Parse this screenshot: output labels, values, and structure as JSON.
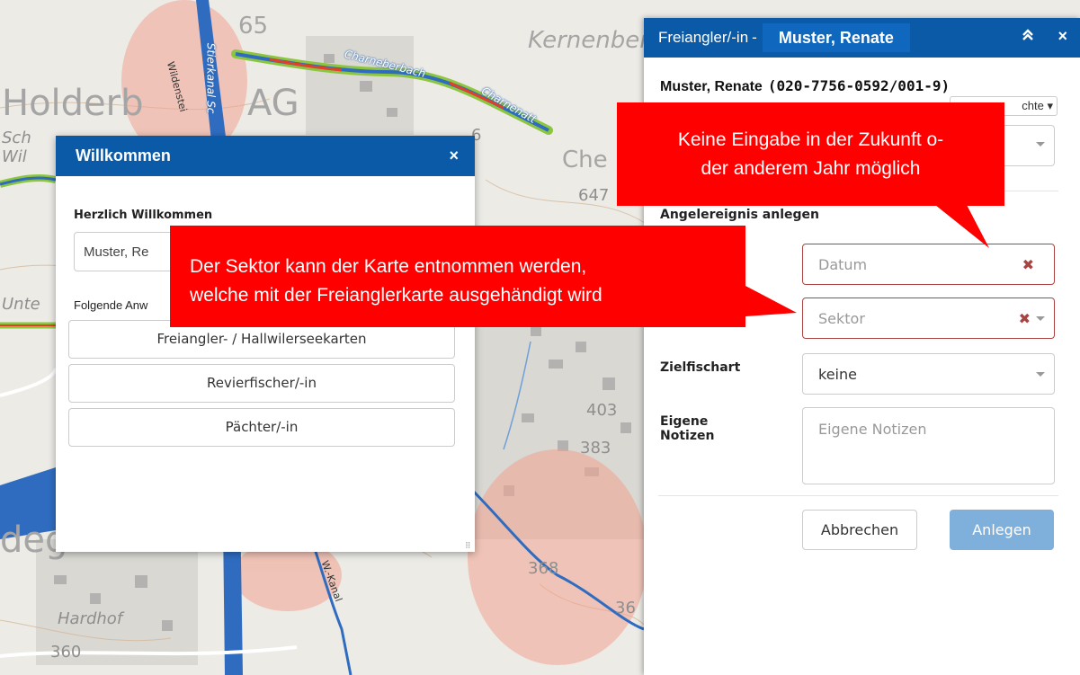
{
  "map": {
    "labels": {
      "holderbank": "Holderb",
      "holderbank_ag": "AG",
      "kernenberg": "Kernenberg",
      "che": "Che",
      "h647": "647",
      "h65": "65",
      "h403": "403",
      "h383": "383",
      "h368": "368",
      "h36": "36",
      "h360": "360",
      "hardhof": "Hardhof",
      "sch": "Sch",
      "wil": "Wil",
      "unte": "Unte",
      "deg": "deg",
      "charneberbach": "Charneberbach",
      "charnenatt": "Charnenatt",
      "stierkanal": "Stierkanal Sc",
      "wildenstein": "Wildenstei",
      "w_kanal": "W.-Kanal",
      "num_6": "6"
    }
  },
  "welcome": {
    "title": "Willkommen",
    "close": "×",
    "greeting_label": "Herzlich Willkommen",
    "name_value": "Muster, Re",
    "apps_label": "Folgende Anw",
    "buttons": [
      "Freiangler- / Hallwilerseekarten",
      "Revierfischer/-in",
      "Pächter/-in"
    ],
    "grip": "⠿"
  },
  "panel": {
    "title": "Freiangler/-in",
    "title_sep": "-",
    "name_chip": "Muster, Renate",
    "collapse_icon": "≈",
    "close": "×",
    "user_name": "Muster, Renate",
    "user_id": "(020-7756-0592/001-9)",
    "rights_dropdown": "chte ▾",
    "section_title": "Angelereignis anlegen",
    "date_placeholder": "Datum",
    "sector_placeholder": "Sektor",
    "target_fish_label": "Zielfischart",
    "target_fish_value": "keine",
    "notes_label_1": "Eigene",
    "notes_label_2": "Notizen",
    "notes_placeholder": "Eigene Notizen",
    "error_icon": "✖",
    "cancel_label": "Abbrechen",
    "create_label": "Anlegen"
  },
  "callouts": {
    "date_note_line1": "Keine Eingabe in der Zukunft o-",
    "date_note_line2": "der anderem Jahr möglich",
    "sector_note_line1": "Der Sektor kann der Karte entnommen werden,",
    "sector_note_line2": "welche mit der Freianglerkarte ausgehändigt wird"
  },
  "colors": {
    "header_blue": "#0a5aa7",
    "callout_red": "#ff0000",
    "error_red": "#a94442",
    "primary_disabled": "#7fb0dc",
    "river_blue": "#2f6cc0",
    "zone_red": "#f3a28f"
  }
}
